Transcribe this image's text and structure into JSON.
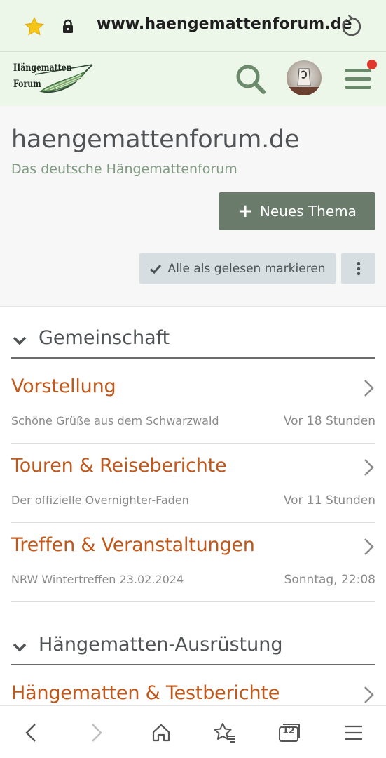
{
  "browser": {
    "url": "www.haengemattenforum.de",
    "icons": [
      "star-icon",
      "lock-icon",
      "reload-icon"
    ]
  },
  "site": {
    "logo_line1": "Hängematten",
    "logo_line2": "Forum",
    "header_icons": [
      "search-icon",
      "avatar",
      "hamburger-menu-icon"
    ]
  },
  "page": {
    "title": "haengemattenforum.de",
    "subtitle": "Das deutsche Hängemattenforum",
    "new_thread_label": "Neues Thema",
    "mark_read_label": "Alle als gelesen markieren"
  },
  "sections": [
    {
      "title": "Gemeinschaft",
      "forums": [
        {
          "name": "Vorstellung",
          "last_thread": "Schöne Grüße aus dem Schwarzwald",
          "time": "Vor 18 Stunden"
        },
        {
          "name": "Touren & Reiseberichte",
          "last_thread": "Der offizielle Overnighter-Faden",
          "time": "Vor 11 Stunden"
        },
        {
          "name": "Treffen & Veranstaltungen",
          "last_thread": "NRW Wintertreffen 23.02.2024",
          "time": "Sonntag, 22:08"
        }
      ]
    },
    {
      "title": "Hängematten-Ausrüstung",
      "forums": [
        {
          "name": "Hängematten & Testberichte"
        }
      ]
    }
  ],
  "bottom_nav": {
    "tab_count": "12",
    "icons": [
      "back-icon",
      "forward-icon",
      "home-icon",
      "bookmarks-icon",
      "tabs-icon",
      "menu-icon"
    ]
  },
  "colors": {
    "header_bg": "#ecf6e9",
    "accent_green": "#6b7b6b",
    "forum_link": "#c0581c",
    "notification": "#e0382c"
  }
}
